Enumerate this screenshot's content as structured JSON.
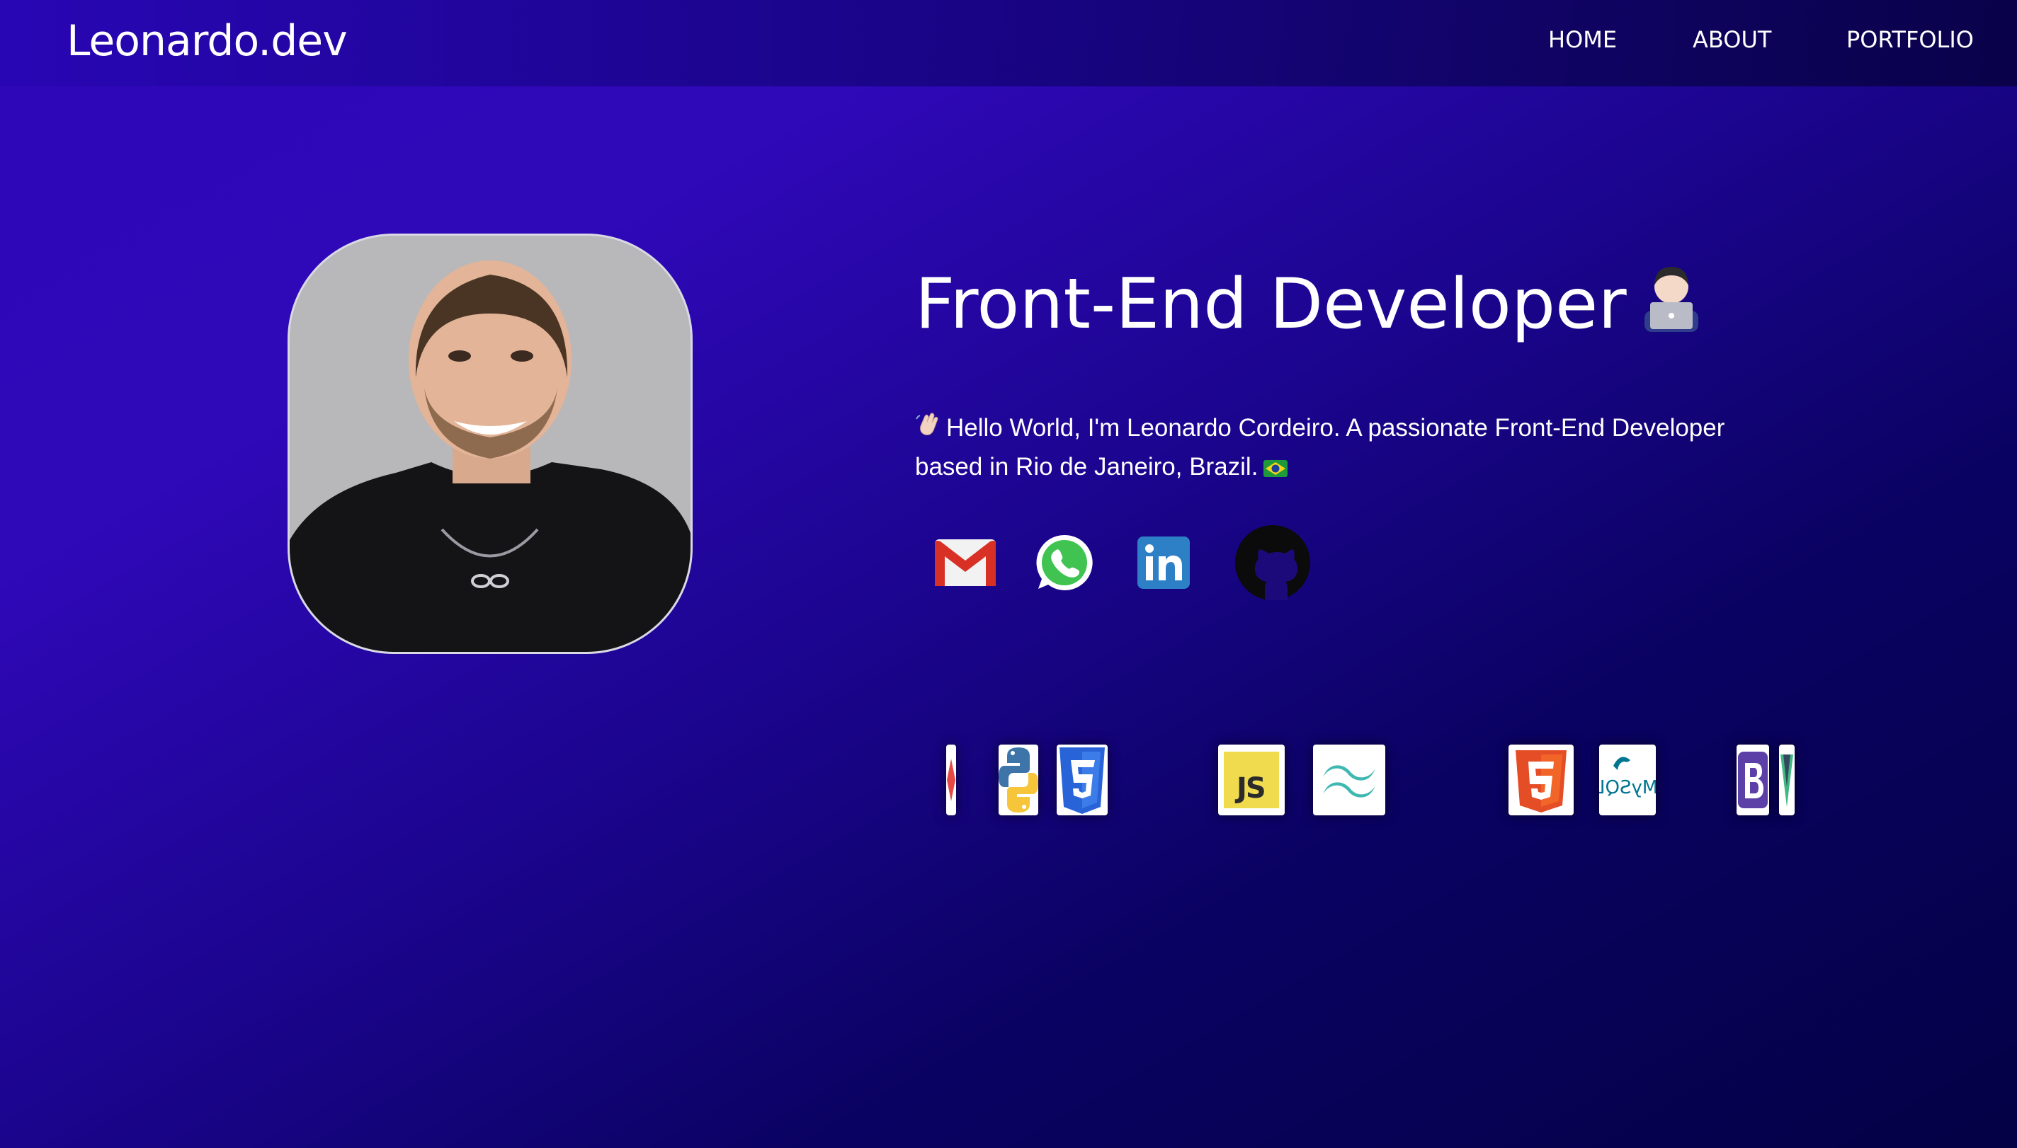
{
  "header": {
    "logo": "Leonardo.dev",
    "nav": {
      "home": "HOME",
      "about": "ABOUT",
      "portfolio": "PORTFOLIO"
    }
  },
  "hero": {
    "title": "Front-End Developer",
    "title_icon": "technologist-icon",
    "bio": "Hello World, I'm Leonardo Cordeiro. A passionate Front-End Developer based in Rio de Janeiro, Brazil.",
    "bio_leading_icon": "waving-hand-icon",
    "bio_trailing_icon": "brazil-flag-icon",
    "photo": "profile-photo"
  },
  "social": [
    {
      "name": "gmail-icon"
    },
    {
      "name": "whatsapp-icon"
    },
    {
      "name": "linkedin-icon"
    },
    {
      "name": "github-icon"
    }
  ],
  "tech_stack": {
    "items": [
      "angular-icon",
      "python-icon",
      "css3-icon",
      "javascript-icon",
      "tailwind-icon",
      "html5-icon",
      "mysql-icon",
      "bootstrap-icon",
      "vue-icon"
    ],
    "js_label": "JS",
    "mysql_label": "MySQL"
  },
  "colors": {
    "background_start": "#2f08b8",
    "background_end": "#040145",
    "text": "#ffffff"
  }
}
